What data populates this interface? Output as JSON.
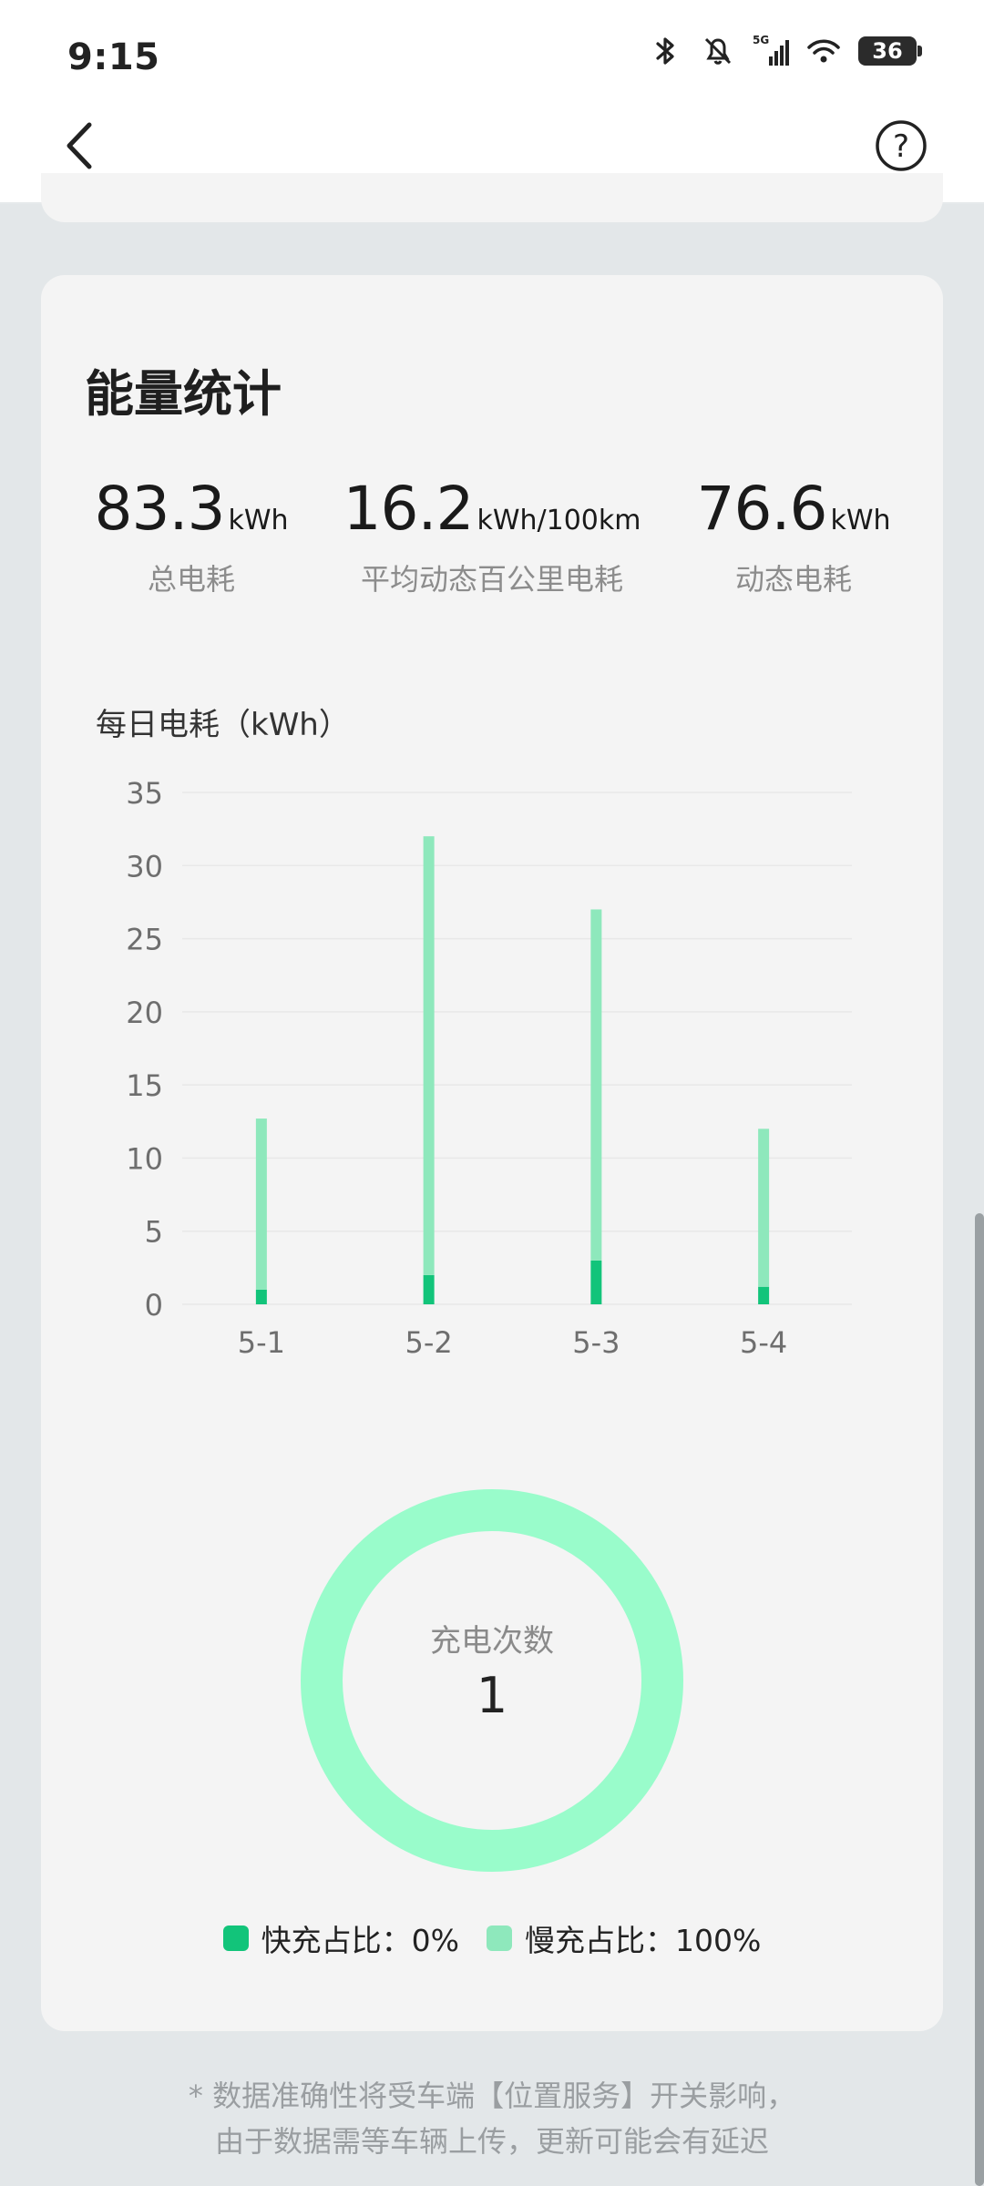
{
  "status_bar": {
    "time": "9:15",
    "battery": "36",
    "icons": [
      "bluetooth-icon",
      "mute-icon",
      "signal-5g-icon",
      "wifi-icon",
      "battery-icon"
    ]
  },
  "nav": {
    "back_icon": "chevron-left-icon",
    "help_icon": "question-circle-icon"
  },
  "card": {
    "title": "能量统计",
    "stats": [
      {
        "value": "83.3",
        "unit": "kWh",
        "label": "总电耗"
      },
      {
        "value": "16.2",
        "unit": "kWh/100km",
        "label": "平均动态百公里电耗"
      },
      {
        "value": "76.6",
        "unit": "kWh",
        "label": "动态电耗"
      }
    ],
    "chart_title": "每日电耗（kWh）",
    "donut": {
      "label": "充电次数",
      "value": "1"
    },
    "legend": {
      "fast": "快充占比：0%",
      "slow": "慢充占比：100%"
    }
  },
  "chart_data": [
    {
      "type": "bar",
      "title": "每日电耗（kWh）",
      "categories": [
        "5-1",
        "5-2",
        "5-3",
        "5-4"
      ],
      "series": [
        {
          "values": [
            1.0,
            2.0,
            3.0,
            1.2
          ],
          "color": "#12c47a"
        },
        {
          "values": [
            11.7,
            30.0,
            24.0,
            10.8
          ],
          "color": "#8ee8bc"
        }
      ],
      "stacked": true,
      "ylim": [
        0,
        35
      ],
      "yticks": [
        0,
        5,
        10,
        15,
        20,
        25,
        30,
        35
      ],
      "grid": true
    },
    {
      "type": "pie",
      "title": "充电次数",
      "slices": [
        {
          "name": "快充",
          "value": 0,
          "color": "#12c47a"
        },
        {
          "name": "慢充",
          "value": 100,
          "color": "#99fccb"
        }
      ]
    }
  ],
  "footnote": {
    "line1": "* 数据准确性将受车端【位置服务】开关影响，",
    "line2": "由于数据需等车辆上传，更新可能会有延迟"
  }
}
